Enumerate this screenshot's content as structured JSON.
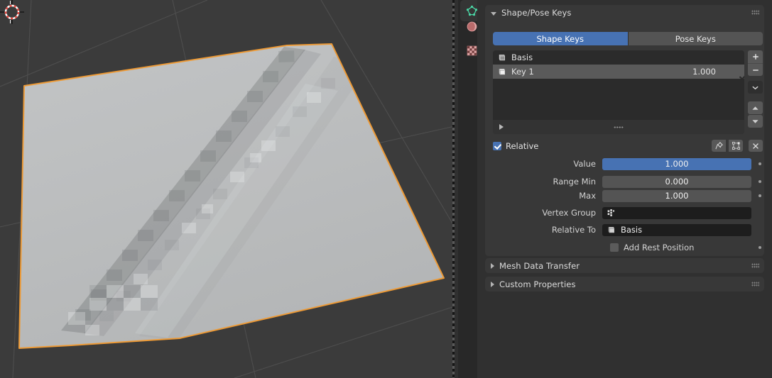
{
  "viewport": {
    "name": "3d-viewport",
    "background_color": "#3b3b3b",
    "grid_color": "#4e4e4e",
    "object_outline_color": "#ed9a36",
    "object_fill_color": "#b9bbbc",
    "cursor_label": "3d-cursor"
  },
  "nav_tabs": [
    {
      "id": "object-data-properties",
      "icon": "mesh-data-icon",
      "color": "#4ad6a5",
      "active": true
    },
    {
      "id": "material-properties",
      "icon": "material-sphere-icon",
      "color": "#cd7b7b",
      "active": false
    },
    {
      "id": "texture-properties",
      "icon": "checker-texture-icon",
      "color": "#cd7b7b",
      "active": false
    }
  ],
  "panels": {
    "shape_pose_keys": {
      "title": "Shape/Pose Keys",
      "expanded": true,
      "tabs": [
        {
          "label": "Shape Keys",
          "selected": true
        },
        {
          "label": "Pose Keys",
          "selected": false
        }
      ],
      "list": {
        "rows": [
          {
            "name": "Basis",
            "value": "",
            "enabled": true,
            "selected": false,
            "icon": "shapekey-icon"
          },
          {
            "name": "Key 1",
            "value": "1.000",
            "enabled": true,
            "selected": true,
            "icon": "shapekey-icon"
          }
        ]
      },
      "side_buttons": [
        {
          "id": "add-shape-key",
          "glyph": "+"
        },
        {
          "id": "remove-shape-key",
          "glyph": "−"
        },
        {
          "id": "shape-key-specials-menu",
          "glyph": "chevron-down-icon"
        },
        {
          "id": "move-shape-key-up",
          "glyph": "triangle-up-icon"
        },
        {
          "id": "move-shape-key-down",
          "glyph": "triangle-down-icon"
        }
      ],
      "relative": {
        "label": "Relative",
        "checked": true,
        "header_icons": [
          {
            "id": "pin-shape-key",
            "icon": "pin-icon"
          },
          {
            "id": "shape-key-edit-mode",
            "icon": "shapekey-edit-icon"
          },
          {
            "id": "close-panel",
            "icon": "close-x-icon"
          }
        ]
      },
      "properties": [
        {
          "label": "Value",
          "value": "1.000",
          "style": "slider-on",
          "animatable": true
        },
        {
          "label": "Range Min",
          "value": "0.000",
          "style": "gray",
          "animatable": true
        },
        {
          "label": "Max",
          "value": "1.000",
          "style": "gray",
          "animatable": true
        },
        {
          "label": "Vertex Group",
          "value": "",
          "style": "dark",
          "icon": "vertex-group-icon",
          "animatable": false
        },
        {
          "label": "Relative To",
          "value": "Basis",
          "style": "dark",
          "icon": "shapekey-icon",
          "animatable": false
        }
      ],
      "add_rest_position": {
        "label": "Add Rest Position",
        "checked": false,
        "animatable": true
      }
    },
    "mesh_data_transfer": {
      "title": "Mesh Data Transfer",
      "expanded": false
    },
    "custom_properties": {
      "title": "Custom Properties",
      "expanded": false
    }
  },
  "theme": {
    "panel_bg": "#383838",
    "editor_bg": "#303030",
    "accent_blue": "#4772b3",
    "field_gray": "#545454",
    "field_dark": "#1d1d1d",
    "list_bg": "#2b2b2b",
    "text": "#e3e3e3"
  }
}
